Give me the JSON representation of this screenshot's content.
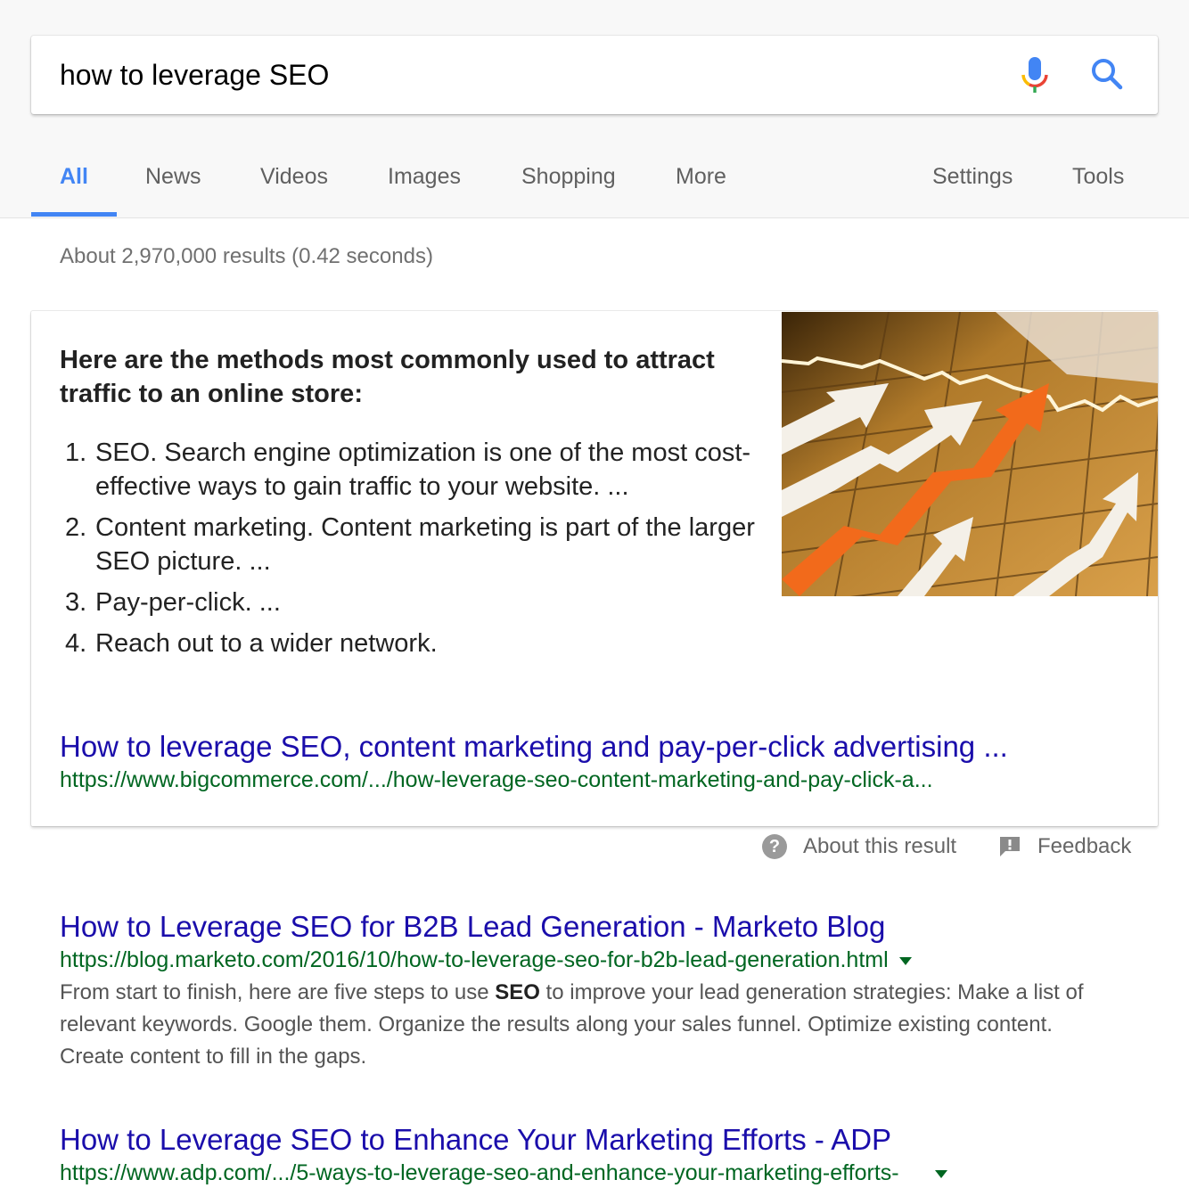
{
  "search": {
    "query": "how to leverage SEO",
    "mic_icon": "microphone-icon",
    "search_icon": "magnifier-icon"
  },
  "tabs": {
    "left": [
      {
        "label": "All",
        "active": true
      },
      {
        "label": "News",
        "active": false
      },
      {
        "label": "Videos",
        "active": false
      },
      {
        "label": "Images",
        "active": false
      },
      {
        "label": "Shopping",
        "active": false
      },
      {
        "label": "More",
        "active": false
      }
    ],
    "right": [
      {
        "label": "Settings"
      },
      {
        "label": "Tools"
      }
    ]
  },
  "stats": "About 2,970,000 results (0.42 seconds)",
  "featured_snippet": {
    "heading": "Here are the methods most commonly used to attract traffic to an online store:",
    "items": [
      {
        "num": "1.",
        "text": "SEO. Search engine optimization is one of the most cost-effective ways to gain traffic to your website. ..."
      },
      {
        "num": "2.",
        "text": "Content marketing. Content marketing is part of the larger SEO picture. ..."
      },
      {
        "num": "3.",
        "text": "Pay-per-click. ..."
      },
      {
        "num": "4.",
        "text": "Reach out to a wider network."
      }
    ],
    "image_alt": "Orange and white rising arrows over a grid chart",
    "link_title": "How to leverage SEO, content marketing and pay-per-click advertising ...",
    "link_url": "https://www.bigcommerce.com/.../how-leverage-seo-content-marketing-and-pay-click-a..."
  },
  "snippet_footer": {
    "about": "About this result",
    "feedback": "Feedback"
  },
  "results": [
    {
      "title": "How to Leverage SEO for B2B Lead Generation - Marketo Blog",
      "url": "https://blog.marketo.com/2016/10/how-to-leverage-seo-for-b2b-lead-generation.html",
      "snippet_before": "From start to finish, here are five steps to use ",
      "snippet_bold": "SEO",
      "snippet_after": " to improve your lead generation strategies: Make a list of relevant keywords. Google them. Organize the results along your sales funnel. Optimize existing content. Create content to fill in the gaps."
    },
    {
      "title": "How to Leverage SEO to Enhance Your Marketing Efforts - ADP",
      "url": "https://www.adp.com/.../5-ways-to-leverage-seo-and-enhance-your-marketing-efforts-"
    }
  ],
  "colors": {
    "accent": "#4285f4",
    "link": "#1a0dab",
    "url": "#006621",
    "snippet": "#545454"
  }
}
